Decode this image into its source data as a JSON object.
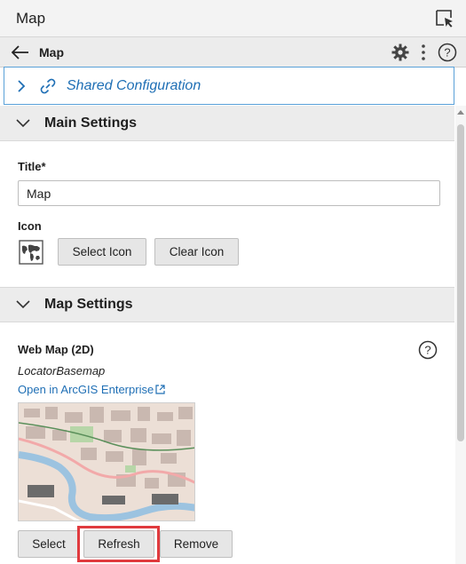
{
  "panel": {
    "title": "Map"
  },
  "subheader": {
    "title": "Map"
  },
  "shared_config": {
    "label": "Shared Configuration"
  },
  "main_settings": {
    "title": "Main Settings",
    "title_label": "Title*",
    "title_value": "Map",
    "icon_label": "Icon",
    "select_icon_label": "Select Icon",
    "clear_icon_label": "Clear Icon"
  },
  "map_settings": {
    "title": "Map Settings",
    "web_map_label": "Web Map (2D)",
    "web_map_name": "LocatorBasemap",
    "open_link": "Open in ArcGIS Enterprise",
    "select_label": "Select",
    "refresh_label": "Refresh",
    "remove_label": "Remove"
  },
  "icons": [
    "select-element-icon",
    "back-arrow-icon",
    "gear-icon",
    "kebab-menu-icon",
    "help-icon",
    "chevron-right-icon",
    "link-icon",
    "chevron-down-icon",
    "world-map-icon",
    "external-link-icon",
    "scroll-up-icon"
  ],
  "colors": {
    "accent": "#1f6fb5",
    "border_accent": "#5aa1d8",
    "highlight": "#e03a3e"
  }
}
